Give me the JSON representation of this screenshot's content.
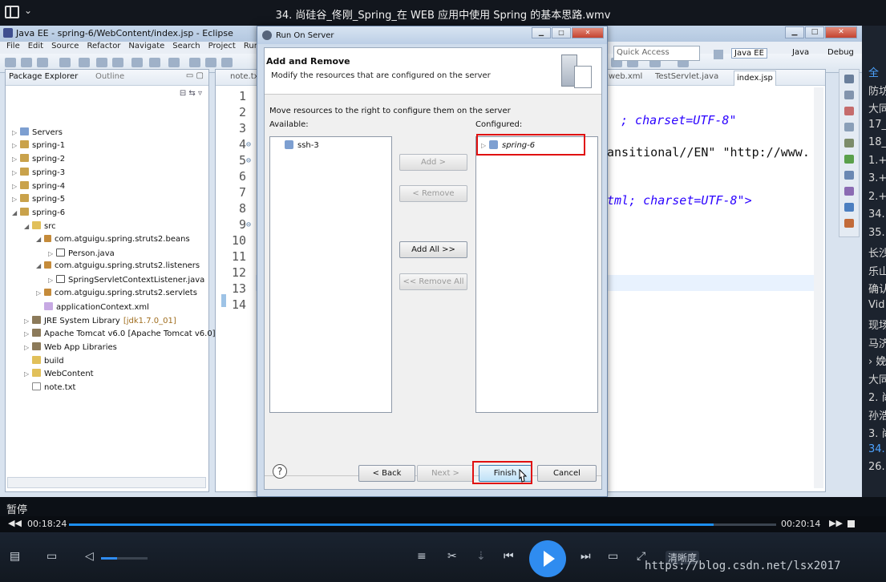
{
  "player": {
    "title": "34. 尚硅谷_佟刚_Spring_在 WEB 应用中使用 Spring 的基本思路.wmv",
    "status": "暂停",
    "time_current": "00:18:24",
    "time_total": "00:20:14",
    "progress": 0.912,
    "volume": 0.35,
    "clarity_label": "清晰度",
    "watermark": "https://blog.csdn.net/lsx2017",
    "playlist": [
      "全",
      "防坊",
      "大同",
      "17_",
      "18_",
      "1.+",
      "3.+",
      "2.+",
      "34.",
      "35.",
      "长沙",
      "乐山",
      "确认",
      "Vid",
      "现场",
      "马济",
      "› 娩",
      "大同",
      "2. 尚",
      "孙浩",
      "3. 尚",
      "34.",
      "26."
    ],
    "icons": [
      "folder-open-icon",
      "volume-icon",
      "equalizer-icon",
      "scissors-icon",
      "download-icon",
      "prev-icon",
      "play-icon",
      "next-icon",
      "screen-icon",
      "fullscreen-icon"
    ]
  },
  "eclipse": {
    "title": "Java EE - spring-6/WebContent/index.jsp - Eclipse",
    "menu": [
      "File",
      "Edit",
      "Source",
      "Refactor",
      "Navigate",
      "Search",
      "Project",
      "Run"
    ],
    "quick_access": "Quick Access",
    "perspectives": [
      "Java EE",
      "Java",
      "Debug"
    ],
    "package_explorer": {
      "tab": "Package Explorer",
      "tab2": "Outline",
      "items": [
        {
          "label": "Servers",
          "level": 0,
          "tw": "▷",
          "icon": "srv"
        },
        {
          "label": "spring-1",
          "level": 0,
          "tw": "▷",
          "icon": "proj"
        },
        {
          "label": "spring-2",
          "level": 0,
          "tw": "▷",
          "icon": "proj"
        },
        {
          "label": "spring-3",
          "level": 0,
          "tw": "▷",
          "icon": "proj"
        },
        {
          "label": "spring-4",
          "level": 0,
          "tw": "▷",
          "icon": "proj"
        },
        {
          "label": "spring-5",
          "level": 0,
          "tw": "▷",
          "icon": "proj"
        },
        {
          "label": "spring-6",
          "level": 0,
          "tw": "◢",
          "icon": "proj"
        },
        {
          "label": "src",
          "level": 1,
          "tw": "◢",
          "icon": "folder"
        },
        {
          "label": "com.atguigu.spring.struts2.beans",
          "level": 2,
          "tw": "◢",
          "icon": "pkgi"
        },
        {
          "label": "Person.java",
          "level": 3,
          "tw": "▷",
          "icon": "java"
        },
        {
          "label": "com.atguigu.spring.struts2.listeners",
          "level": 2,
          "tw": "◢",
          "icon": "pkgi"
        },
        {
          "label": "SpringServletContextListener.java",
          "level": 3,
          "tw": "▷",
          "icon": "java"
        },
        {
          "label": "com.atguigu.spring.struts2.servlets",
          "level": 2,
          "tw": "▷",
          "icon": "pkgi"
        },
        {
          "label": "applicationContext.xml",
          "level": 2,
          "tw": "",
          "icon": "xml"
        },
        {
          "label": "JRE System Library",
          "suffix": "[jdk1.7.0_01]",
          "level": 1,
          "tw": "▷",
          "icon": "lib"
        },
        {
          "label": "Apache Tomcat v6.0 [Apache Tomcat v6.0]",
          "level": 1,
          "tw": "▷",
          "icon": "lib"
        },
        {
          "label": "Web App Libraries",
          "level": 1,
          "tw": "▷",
          "icon": "lib"
        },
        {
          "label": "build",
          "level": 1,
          "tw": "",
          "icon": "folder"
        },
        {
          "label": "WebContent",
          "level": 1,
          "tw": "▷",
          "icon": "folder"
        },
        {
          "label": "note.txt",
          "level": 1,
          "tw": "",
          "icon": "txt"
        }
      ]
    },
    "editor": {
      "tabs": [
        "note.txt",
        "web.xml",
        "TestServlet.java",
        "index.jsp"
      ],
      "line_numbers": [
        "1",
        "2",
        "3",
        "4",
        "5",
        "6",
        "7",
        "8",
        "9",
        "10",
        "11",
        "12",
        "13",
        "14"
      ],
      "fold_lines": [
        "4",
        "5",
        "9"
      ],
      "code_fragments": [
        "; charset=UTF-8\"",
        "ansitional//EN\" \"http://www.",
        "tml; charset=UTF-8\">"
      ]
    }
  },
  "dialog": {
    "title": "Run On Server",
    "heading": "Add and Remove",
    "subheading": "Modify the resources that are configured on the server",
    "instruction": "Move resources to the right to configure them on the server",
    "available_label": "Available:",
    "configured_label": "Configured:",
    "available_items": [
      "ssh-3"
    ],
    "configured_items": [
      "spring-6"
    ],
    "buttons": {
      "add": "Add >",
      "remove": "< Remove",
      "add_all": "Add All >>",
      "remove_all": "<< Remove All",
      "back": "< Back",
      "next": "Next >",
      "finish": "Finish",
      "cancel": "Cancel",
      "help": "?"
    },
    "highlight_color": "#e01010"
  }
}
